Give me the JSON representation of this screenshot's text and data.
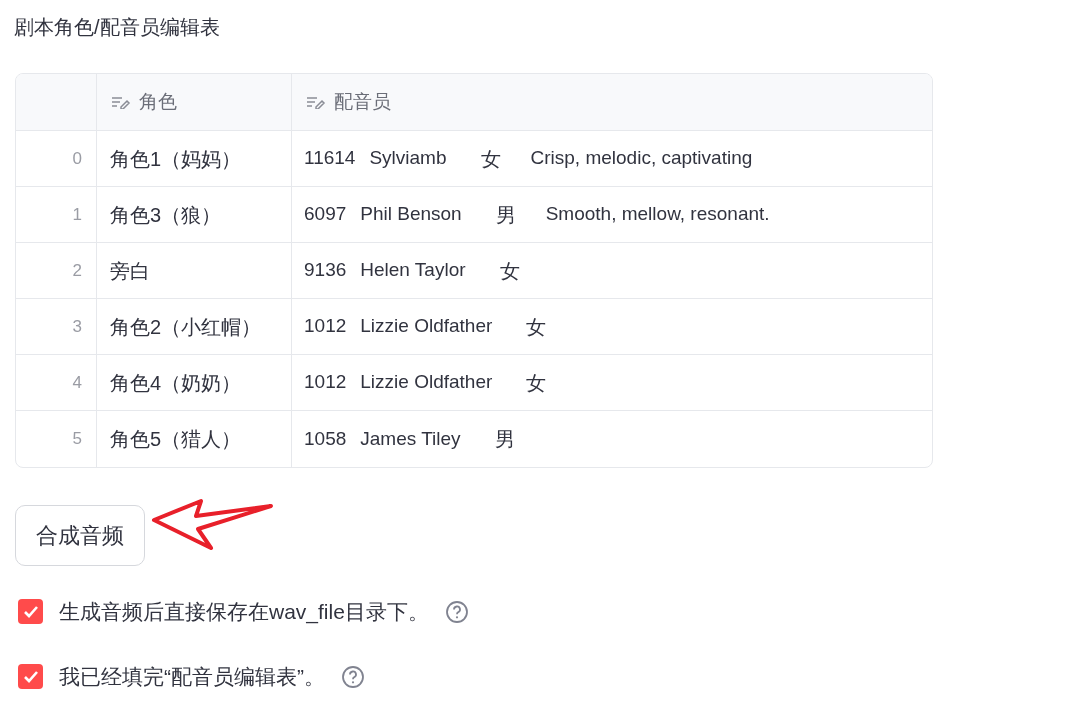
{
  "title": "剧本角色/配音员编辑表",
  "table": {
    "columns": [
      {
        "label": "角色"
      },
      {
        "label": "配音员"
      }
    ],
    "rows": [
      {
        "index": "0",
        "role": "角色1（妈妈）",
        "voice": [
          "11614",
          "Sylviamb",
          "女",
          "Crisp, melodic, captivating"
        ]
      },
      {
        "index": "1",
        "role": "角色3（狼）",
        "voice": [
          "6097",
          "Phil Benson",
          "男",
          "Smooth, mellow, resonant."
        ]
      },
      {
        "index": "2",
        "role": "旁白",
        "voice": [
          "9136",
          "Helen Taylor",
          "女"
        ]
      },
      {
        "index": "3",
        "role": "角色2（小红帽）",
        "voice": [
          "1012",
          "Lizzie Oldfather",
          "女"
        ]
      },
      {
        "index": "4",
        "role": "角色4（奶奶）",
        "voice": [
          "1012",
          "Lizzie Oldfather",
          "女"
        ]
      },
      {
        "index": "5",
        "role": "角色5（猎人）",
        "voice": [
          "1058",
          "James Tiley",
          "男"
        ]
      }
    ]
  },
  "button": "合成音频",
  "checkboxes": [
    {
      "label": "生成音频后直接保存在wav_file目录下。",
      "checked": true
    },
    {
      "label": "我已经填完“配音员编辑表”。",
      "checked": true
    }
  ]
}
